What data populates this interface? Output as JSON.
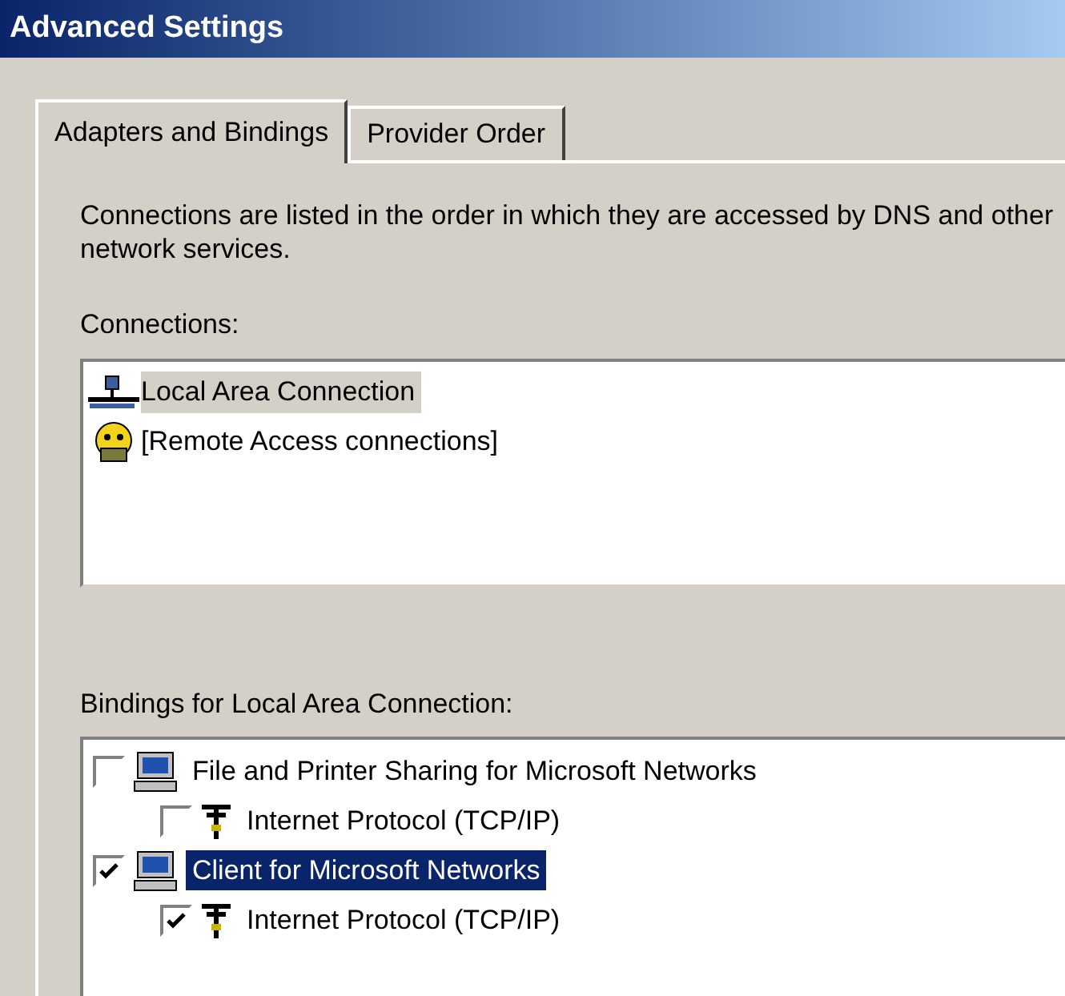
{
  "window": {
    "title": "Advanced Settings"
  },
  "tabs": [
    {
      "label": "Adapters and Bindings",
      "selected": true
    },
    {
      "label": "Provider Order",
      "selected": false
    }
  ],
  "description": "Connections are listed in the order in which they are accessed by DNS and other network services.",
  "connections": {
    "label": "Connections:",
    "items": [
      {
        "kind": "lan",
        "label": "Local Area Connection",
        "selected": true
      },
      {
        "kind": "remote",
        "label": "[Remote Access connections]",
        "selected": false
      }
    ]
  },
  "bindings": {
    "label": "Bindings for Local Area Connection:",
    "items": [
      {
        "kind": "service",
        "label": "File and Printer Sharing for Microsoft Networks",
        "checked": false,
        "selected": false,
        "children": [
          {
            "kind": "protocol",
            "label": "Internet Protocol (TCP/IP)",
            "checked": false,
            "selected": false
          }
        ]
      },
      {
        "kind": "service",
        "label": "Client for Microsoft Networks",
        "checked": true,
        "selected": true,
        "children": [
          {
            "kind": "protocol",
            "label": "Internet Protocol (TCP/IP)",
            "checked": true,
            "selected": false
          }
        ]
      }
    ]
  }
}
